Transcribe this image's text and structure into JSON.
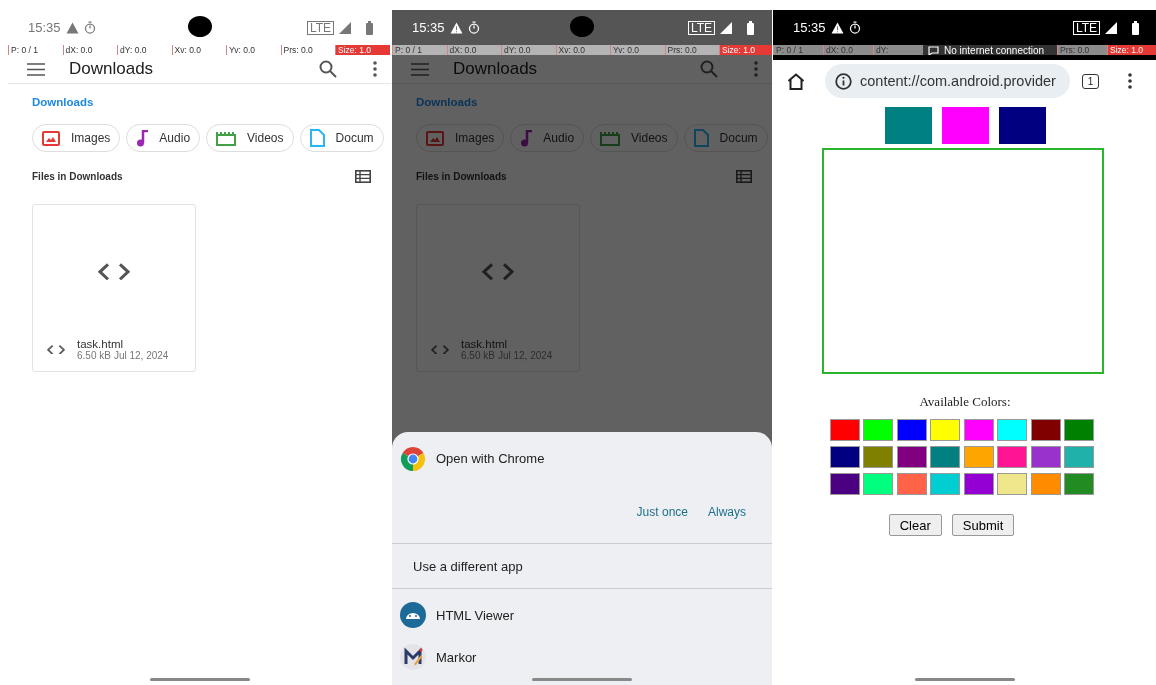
{
  "screens": [
    {
      "kind": "files",
      "dimmed": false,
      "status": {
        "time": "15:35",
        "network": "LTE"
      },
      "pointer": [
        {
          "kind": "reading",
          "text": "P: 0 / 1",
          "highlighted": false
        },
        {
          "kind": "reading",
          "text": "dX: 0.0",
          "highlighted": false
        },
        {
          "kind": "reading",
          "text": "dY: 0.0",
          "highlighted": false
        },
        {
          "kind": "reading",
          "text": "Xv: 0.0",
          "highlighted": false
        },
        {
          "kind": "reading",
          "text": "Yv: 0.0",
          "highlighted": false
        },
        {
          "kind": "reading",
          "text": "Prs: 0.0",
          "highlighted": false
        },
        {
          "kind": "reading",
          "text": "Size: 1.0",
          "highlighted": true
        }
      ],
      "title": "Downloads",
      "tabs": [
        {
          "label": "Downloads",
          "selected": true
        }
      ],
      "chips": [
        {
          "label": "Images"
        },
        {
          "label": "Audio"
        },
        {
          "label": "Videos"
        },
        {
          "label": "Docum"
        }
      ],
      "section": "Files in Downloads",
      "files": [
        {
          "name": "task.html",
          "size": "6.50 kB",
          "date": "Jul 12, 2024"
        }
      ]
    },
    {
      "kind": "files",
      "dimmed": true,
      "status": {
        "time": "15:35",
        "network": "LTE"
      },
      "pointer": [
        {
          "kind": "reading",
          "text": "P: 0 / 1",
          "highlighted": false
        },
        {
          "kind": "reading",
          "text": "dX: 0.0",
          "highlighted": false
        },
        {
          "kind": "reading",
          "text": "dY: 0.0",
          "highlighted": false
        },
        {
          "kind": "reading",
          "text": "Xv: 0.0",
          "highlighted": false
        },
        {
          "kind": "reading",
          "text": "Yv: 0.0",
          "highlighted": false
        },
        {
          "kind": "reading",
          "text": "Prs: 0.0",
          "highlighted": false
        },
        {
          "kind": "reading",
          "text": "Size: 1.0",
          "highlighted": true
        }
      ],
      "title": "Downloads",
      "tabs": [
        {
          "label": "Downloads",
          "selected": true
        }
      ],
      "chips": [
        {
          "label": "Images"
        },
        {
          "label": "Audio"
        },
        {
          "label": "Videos"
        },
        {
          "label": "Docum"
        }
      ],
      "section": "Files in Downloads",
      "files": [
        {
          "name": "task.html",
          "size": "6.50 kB",
          "date": "Jul 12, 2024"
        }
      ],
      "chooser": {
        "title": "Open with Chrome",
        "buttons": [
          "Just once",
          "Always"
        ],
        "other": "Use a different app",
        "apps": [
          {
            "name": "HTML Viewer"
          },
          {
            "name": "Markor"
          }
        ]
      }
    },
    {
      "kind": "browser",
      "status": {
        "time": "15:35",
        "network": "LTE"
      },
      "pointer": [
        {
          "kind": "reading",
          "text": "P: 0 / 1",
          "highlighted": false
        },
        {
          "kind": "reading",
          "text": "dX: 0.0",
          "highlighted": false
        },
        {
          "kind": "reading",
          "text": "dY:",
          "highlighted": false
        },
        {
          "kind": "toast",
          "text": "No internet connection"
        },
        {
          "kind": "reading",
          "text": "Prs: 0.0",
          "highlighted": false
        },
        {
          "kind": "reading",
          "text": "Size: 1.0",
          "highlighted": true
        }
      ],
      "url": "content://com.android.provider",
      "tab_count": "1",
      "selected_colors": [
        {
          "color": "#008080"
        },
        {
          "color": "#ff00ff"
        },
        {
          "color": "#000080"
        }
      ],
      "palette_title": "Available Colors:",
      "palette": [
        {
          "color": "#ff0000"
        },
        {
          "color": "#00ff00"
        },
        {
          "color": "#0000ff"
        },
        {
          "color": "#ffff00"
        },
        {
          "color": "#ff00ff"
        },
        {
          "color": "#00ffff"
        },
        {
          "color": "#800000"
        },
        {
          "color": "#008000"
        },
        {
          "color": "#000080"
        },
        {
          "color": "#808000"
        },
        {
          "color": "#800080"
        },
        {
          "color": "#008080"
        },
        {
          "color": "#ffa500"
        },
        {
          "color": "#ff1493"
        },
        {
          "color": "#9932cc"
        },
        {
          "color": "#20b2aa"
        },
        {
          "color": "#4b0082"
        },
        {
          "color": "#00ff7f"
        },
        {
          "color": "#ff6347"
        },
        {
          "color": "#00ced1"
        },
        {
          "color": "#9400d3"
        },
        {
          "color": "#f0e68c"
        },
        {
          "color": "#ff8c00"
        },
        {
          "color": "#228b22"
        }
      ],
      "buttons": [
        "Clear",
        "Submit"
      ]
    }
  ]
}
